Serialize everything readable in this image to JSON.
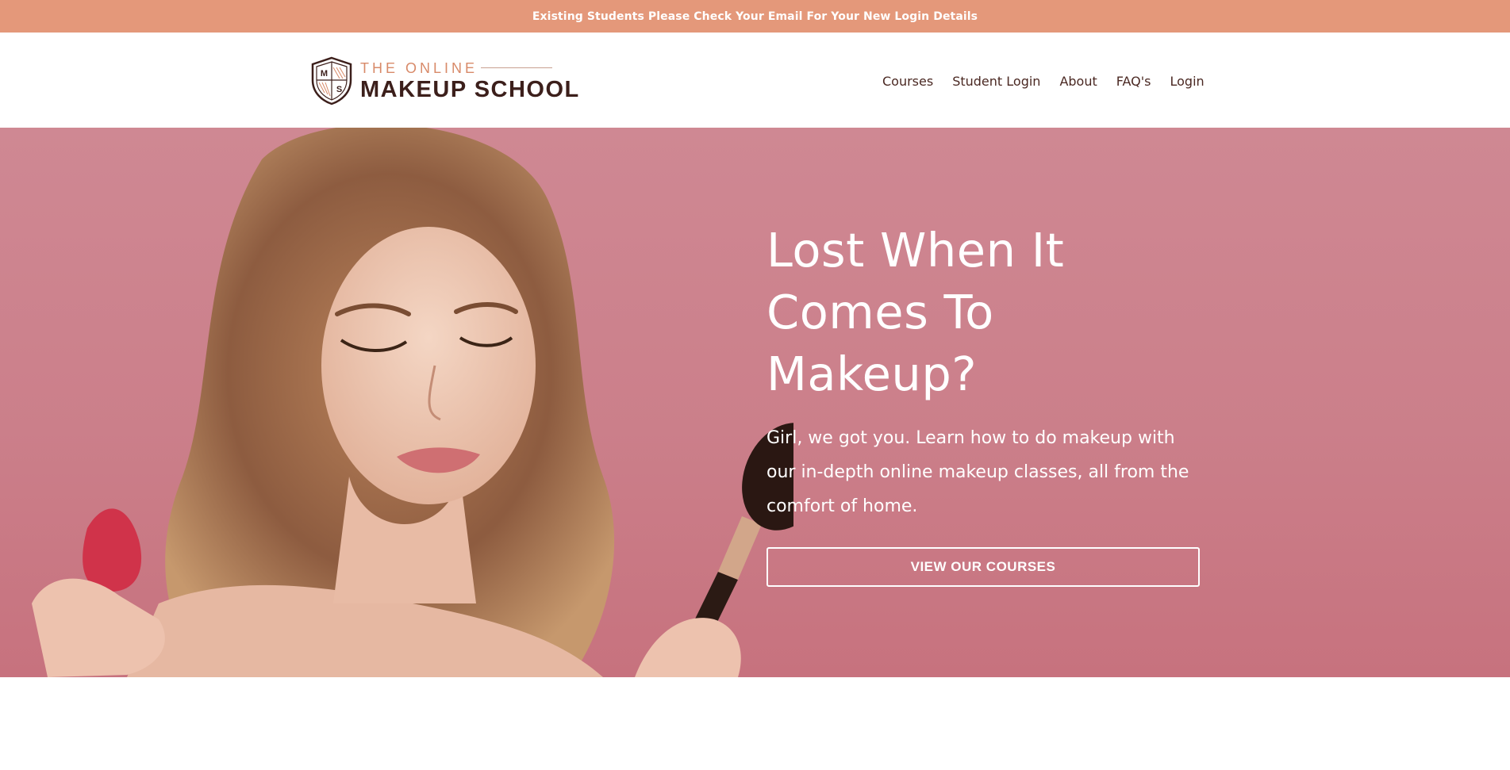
{
  "announcement": {
    "text": "Existing Students Please Check Your Email For Your New Login Details"
  },
  "brand": {
    "logo_top": "THE ONLINE",
    "logo_bottom": "MAKEUP SCHOOL",
    "crest_letters": [
      "M",
      "S"
    ]
  },
  "nav": {
    "items": [
      {
        "label": "Courses"
      },
      {
        "label": "Student Login"
      },
      {
        "label": "About"
      },
      {
        "label": "FAQ's"
      },
      {
        "label": "Login"
      }
    ]
  },
  "hero": {
    "title_lines": [
      "Lost When It",
      "Comes To",
      "Makeup?"
    ],
    "description": "Girl, we got you. Learn how to do makeup with our in-depth online makeup classes, all from the comfort of home.",
    "cta_label": "VIEW OUR COURSES"
  },
  "colors": {
    "announcement_bg": "#e4987a",
    "brand_dark": "#3c1f1b",
    "brand_accent": "#d88a69",
    "hero_bg": "#cb7f8a",
    "text_on_hero": "#ffffff"
  }
}
